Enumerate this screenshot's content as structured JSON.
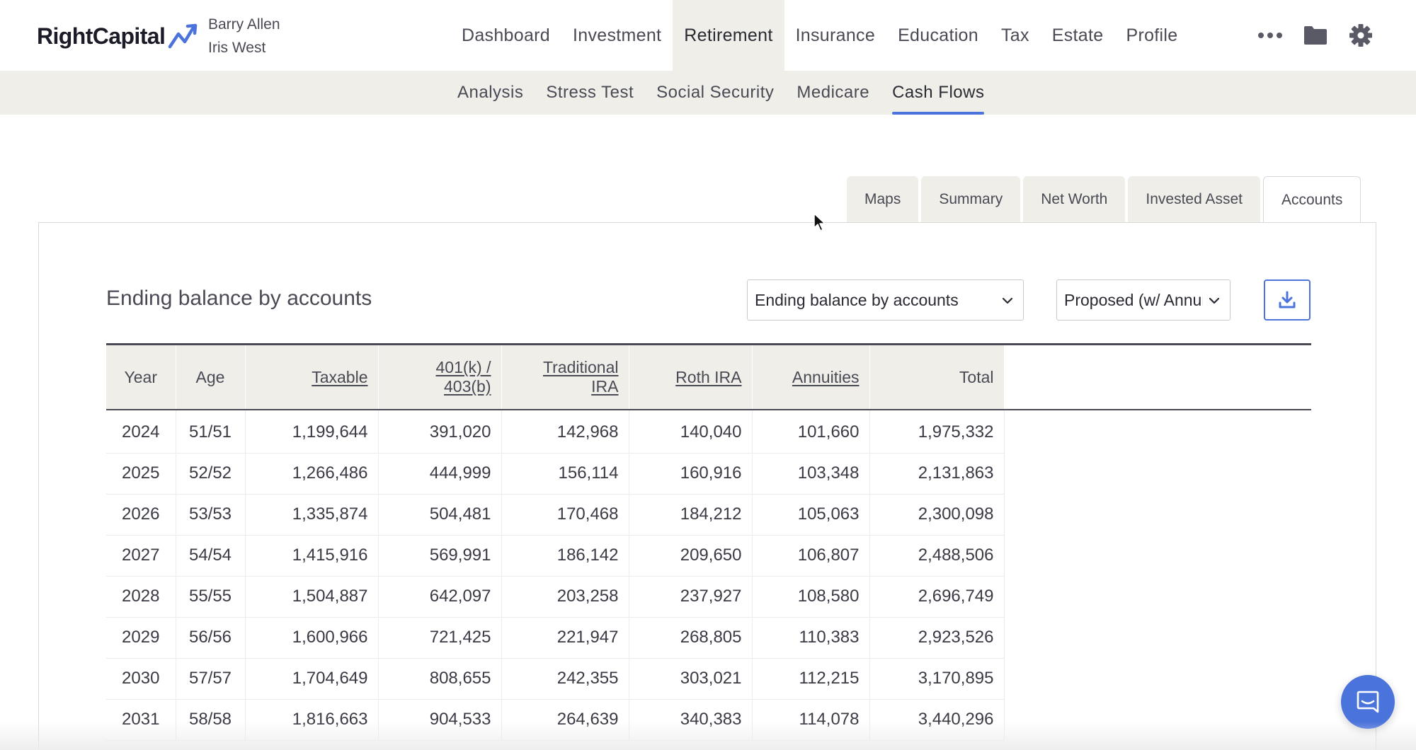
{
  "brand": {
    "name": "RightCapital"
  },
  "clients": {
    "primary": "Barry Allen",
    "spouse": "Iris West"
  },
  "main_nav": [
    {
      "label": "Dashboard",
      "active": false
    },
    {
      "label": "Investment",
      "active": false
    },
    {
      "label": "Retirement",
      "active": true
    },
    {
      "label": "Insurance",
      "active": false
    },
    {
      "label": "Education",
      "active": false
    },
    {
      "label": "Tax",
      "active": false
    },
    {
      "label": "Estate",
      "active": false
    },
    {
      "label": "Profile",
      "active": false
    }
  ],
  "nav_icons": {
    "more": "more-horizontal-icon",
    "vault": "folder-icon",
    "settings": "gear-icon"
  },
  "sub_nav": [
    {
      "label": "Analysis",
      "active": false
    },
    {
      "label": "Stress Test",
      "active": false
    },
    {
      "label": "Social Security",
      "active": false
    },
    {
      "label": "Medicare",
      "active": false
    },
    {
      "label": "Cash Flows",
      "active": true
    }
  ],
  "view_tabs": [
    {
      "label": "Maps",
      "active": false
    },
    {
      "label": "Summary",
      "active": false
    },
    {
      "label": "Net Worth",
      "active": false
    },
    {
      "label": "Invested Asset",
      "active": false
    },
    {
      "label": "Accounts",
      "active": true
    }
  ],
  "panel": {
    "title": "Ending balance by accounts",
    "view_select": {
      "value": "Ending balance by accounts"
    },
    "scenario_select": {
      "value": "Proposed (w/ Annuity)"
    },
    "download": {
      "icon": "download-icon"
    }
  },
  "table": {
    "headers": {
      "year": "Year",
      "age": "Age",
      "taxable": "Taxable",
      "k401_line1": "401(k) /",
      "k401_line2": "403(b)",
      "trad_line1": "Traditional",
      "trad_line2": "IRA",
      "roth": "Roth IRA",
      "annuities": "Annuities",
      "total": "Total"
    },
    "rows": [
      {
        "year": "2024",
        "age": "51/51",
        "taxable": "1,199,644",
        "k401": "391,020",
        "trad": "142,968",
        "roth": "140,040",
        "annuities": "101,660",
        "total": "1,975,332"
      },
      {
        "year": "2025",
        "age": "52/52",
        "taxable": "1,266,486",
        "k401": "444,999",
        "trad": "156,114",
        "roth": "160,916",
        "annuities": "103,348",
        "total": "2,131,863"
      },
      {
        "year": "2026",
        "age": "53/53",
        "taxable": "1,335,874",
        "k401": "504,481",
        "trad": "170,468",
        "roth": "184,212",
        "annuities": "105,063",
        "total": "2,300,098"
      },
      {
        "year": "2027",
        "age": "54/54",
        "taxable": "1,415,916",
        "k401": "569,991",
        "trad": "186,142",
        "roth": "209,650",
        "annuities": "106,807",
        "total": "2,488,506"
      },
      {
        "year": "2028",
        "age": "55/55",
        "taxable": "1,504,887",
        "k401": "642,097",
        "trad": "203,258",
        "roth": "237,927",
        "annuities": "108,580",
        "total": "2,696,749"
      },
      {
        "year": "2029",
        "age": "56/56",
        "taxable": "1,600,966",
        "k401": "721,425",
        "trad": "221,947",
        "roth": "268,805",
        "annuities": "110,383",
        "total": "2,923,526"
      },
      {
        "year": "2030",
        "age": "57/57",
        "taxable": "1,704,649",
        "k401": "808,655",
        "trad": "242,355",
        "roth": "303,021",
        "annuities": "112,215",
        "total": "3,170,895"
      },
      {
        "year": "2031",
        "age": "58/58",
        "taxable": "1,816,663",
        "k401": "904,533",
        "trad": "264,639",
        "roth": "340,383",
        "annuities": "114,078",
        "total": "3,440,296"
      }
    ]
  },
  "chat": {
    "icon": "chat-icon"
  },
  "colors": {
    "accent": "#4b73dc",
    "nav_bg": "#efeee9",
    "text": "#3d3d48"
  }
}
